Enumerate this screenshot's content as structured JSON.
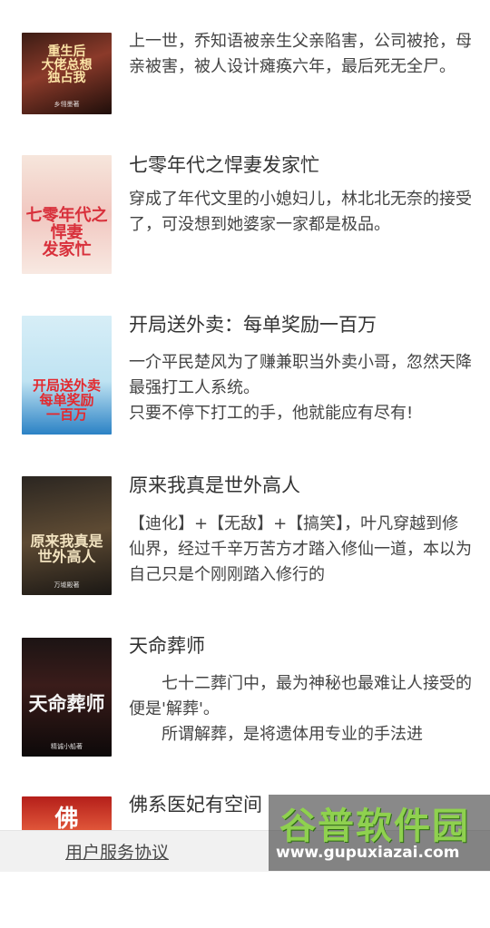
{
  "books": [
    {
      "title": "",
      "description": "上一世，乔知语被亲生父亲陷害，公司被抢，母亲被害，被人设计瘫痪六年，最后死无全尸。",
      "cover_text": "重生后\n大佬总想\n独占我",
      "cover_author": "乡翎墨著"
    },
    {
      "title": "七零年代之悍妻发家忙",
      "description": "穿成了年代文里的小媳妇儿，林北北无奈的接受了，可没想到她婆家一家都是极品。",
      "cover_text": "七零年代之\n悍妻\n发家忙",
      "cover_author": ""
    },
    {
      "title": "开局送外卖：每单奖励一百万",
      "description": "一介平民楚风为了赚兼职当外卖小哥，忽然天降最强打工人系统。\n只要不停下打工的手，他就能应有尽有!",
      "cover_text": "开局送外卖\n每单奖励\n一百万",
      "cover_author": ""
    },
    {
      "title": "原来我真是世外高人",
      "description": "【迪化】+【无敌】+【搞笑】，叶凡穿越到修仙界，经过千辛万苦方才踏入修仙一道，本以为自己只是个刚刚踏入修行的",
      "cover_text": "原来我真是\n世外高人",
      "cover_author": "万墟殿著"
    },
    {
      "title": "天命葬师",
      "description": "　　七十二葬门中，最为神秘也最难让人接受的便是'解葬'。\n　　所谓解葬，是将遗体用专业的手法进",
      "cover_text": "天命葬师",
      "cover_author": "精诚小船著"
    },
    {
      "title": "佛系医妃有空间",
      "description": "",
      "cover_text": "佛",
      "cover_author": ""
    }
  ],
  "footer": {
    "link_label": "用户服务协议"
  },
  "watermark": {
    "name": "谷普软件园",
    "url": "www.gupuxiazai.com"
  }
}
